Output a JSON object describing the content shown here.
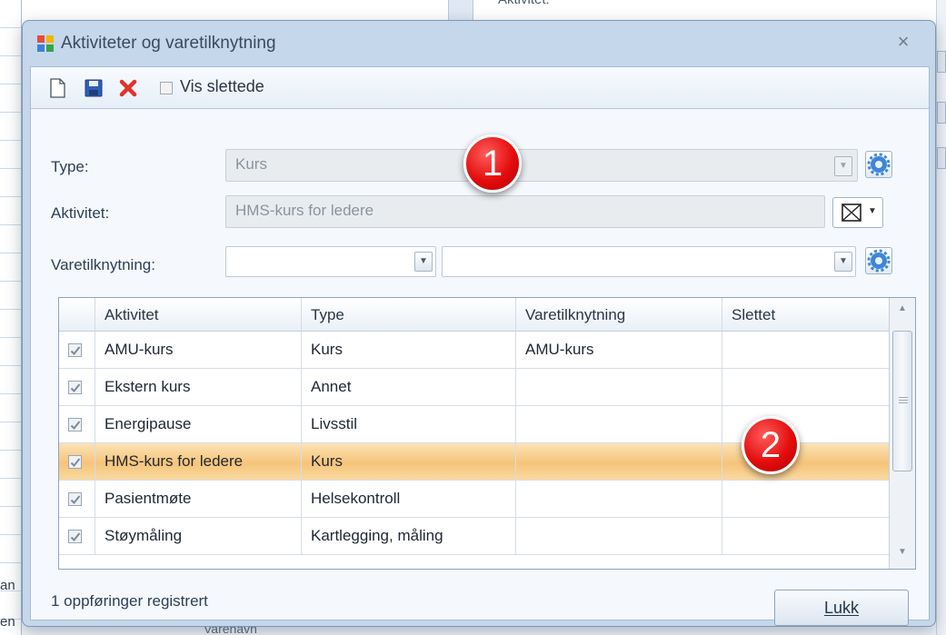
{
  "background": {
    "top_label": "Aktivitet:",
    "bottom_left_1": "an",
    "bottom_left_2": "en",
    "bottom_text": "Varenavn"
  },
  "dialog": {
    "title": "Aktiviteter og varetilknytning",
    "close_glyph": "×"
  },
  "toolbar": {
    "show_deleted_label": "Vis slettede",
    "show_deleted_checked": false
  },
  "form": {
    "type_label": "Type:",
    "type_value": "Kurs",
    "activity_label": "Aktivitet:",
    "activity_value": "HMS-kurs for ledere",
    "link_label": "Varetilknytning:",
    "link_value_1": "",
    "link_value_2": ""
  },
  "grid": {
    "columns": [
      "Aktivitet",
      "Type",
      "Varetilknytning",
      "Slettet"
    ],
    "rows": [
      {
        "checked": true,
        "aktivitet": "AMU-kurs",
        "type": "Kurs",
        "varetilknytning": "AMU-kurs",
        "slettet": ""
      },
      {
        "checked": true,
        "aktivitet": "Ekstern kurs",
        "type": "Annet",
        "varetilknytning": "",
        "slettet": ""
      },
      {
        "checked": true,
        "aktivitet": "Energipause",
        "type": "Livsstil",
        "varetilknytning": "",
        "slettet": ""
      },
      {
        "checked": true,
        "aktivitet": "HMS-kurs for ledere",
        "type": "Kurs",
        "varetilknytning": "",
        "slettet": "",
        "selected": true
      },
      {
        "checked": true,
        "aktivitet": "Pasientmøte",
        "type": "Helsekontroll",
        "varetilknytning": "",
        "slettet": ""
      },
      {
        "checked": true,
        "aktivitet": "Støymåling",
        "type": "Kartlegging, måling",
        "varetilknytning": "",
        "slettet": ""
      }
    ]
  },
  "status_text": "1 oppføringer registrert",
  "close_button_label": "Lukk",
  "markers": {
    "one": "1",
    "two": "2"
  },
  "colors": {
    "marker_red": "#e40d0d",
    "selection_orange": "#f6c47a",
    "dialog_blue": "#c5d7eb"
  }
}
